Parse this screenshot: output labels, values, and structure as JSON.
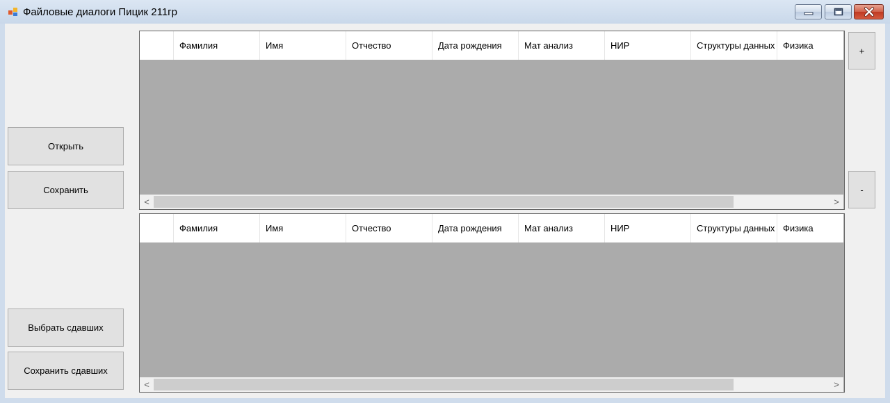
{
  "window": {
    "title": "Файловые диалоги Пицик 211гр"
  },
  "buttons": {
    "open": "Открыть",
    "save": "Сохранить",
    "select_passed": "Выбрать сдавших",
    "save_passed": "Сохранить сдавших",
    "add": "+",
    "remove": "-"
  },
  "grid_top": {
    "columns": [
      "Фамилия",
      "Имя",
      "Отчество",
      "Дата рождения",
      "Мат анализ",
      "НИР",
      "Структуры данных",
      "Физика"
    ]
  },
  "grid_bottom": {
    "columns": [
      "Фамилия",
      "Имя",
      "Отчество",
      "Дата рождения",
      "Мат анализ",
      "НИР",
      "Структуры данных",
      "Физика"
    ]
  },
  "scroll": {
    "left_arrow": "<",
    "right_arrow": ">"
  },
  "colors": {
    "grid_background": "#ababab",
    "form_background": "#f0f0f0",
    "close_button": "#c7432b"
  },
  "icons": {
    "app": "windows-forms-app-icon",
    "minimize": "minimize-icon",
    "maximize": "maximize-icon",
    "close": "close-icon"
  }
}
